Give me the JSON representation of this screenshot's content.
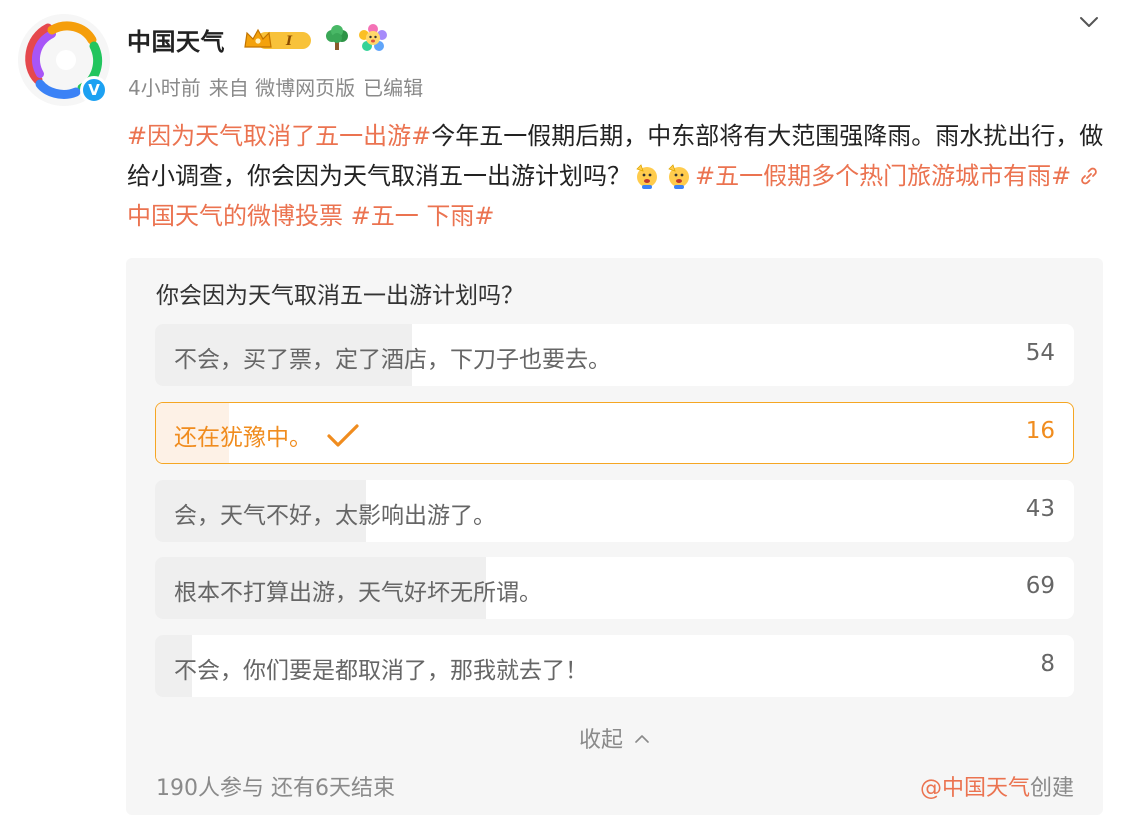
{
  "author": {
    "name": "中国天气",
    "vip_level": "I",
    "verified_mark": "V"
  },
  "meta": {
    "time": "4小时前",
    "source": "来自 微博网页版",
    "edited": "已编辑"
  },
  "content": {
    "topic1": "#因为天气取消了五一出游#",
    "text1": "今年五一假期后期，中东部将有大范围强降雨。雨水扰出行，做给小调查，你会因为天气取消五一出游计划吗？",
    "topic2": "#五一假期多个热门旅游城市有雨#",
    "link_text": "中国天气的微博投票",
    "topic3": "#五一 下雨#"
  },
  "poll": {
    "question": "你会因为天气取消五一出游计划吗？",
    "options": [
      {
        "label": "不会，买了票，定了酒店，下刀子也要去。",
        "count": "54",
        "fraction": 0.28,
        "selected": false
      },
      {
        "label": "还在犹豫中。",
        "count": "16",
        "fraction": 0.08,
        "selected": true
      },
      {
        "label": "会，天气不好，太影响出游了。",
        "count": "43",
        "fraction": 0.23,
        "selected": false
      },
      {
        "label": "根本不打算出游，天气好坏无所谓。",
        "count": "69",
        "fraction": 0.36,
        "selected": false
      },
      {
        "label": "不会，你们要是都取消了，那我就去了！",
        "count": "8",
        "fraction": 0.04,
        "selected": false
      }
    ],
    "collapse_label": "收起",
    "participants": "190人参与",
    "remaining": "还有6天结束",
    "creator_mention": "@中国天气",
    "creator_suffix": "创建"
  },
  "colors": {
    "accent": "#eb7350",
    "selected_orange": "#f08c1e",
    "selected_border": "#f5a623",
    "poll_bg": "#f6f6f6",
    "bar_fill": "#efefef",
    "verified_blue": "#1da1f2"
  },
  "icons": {
    "menu": "chevron-down-icon",
    "avatar": "rainbow-logo",
    "badges": [
      "crown-vip-icon",
      "tree-icon",
      "flower-icon"
    ],
    "inline_emoji": [
      "waving-face-icon",
      "waving-face-icon"
    ],
    "link": "link-icon",
    "check": "check-icon",
    "collapse": "chevron-up-icon"
  }
}
